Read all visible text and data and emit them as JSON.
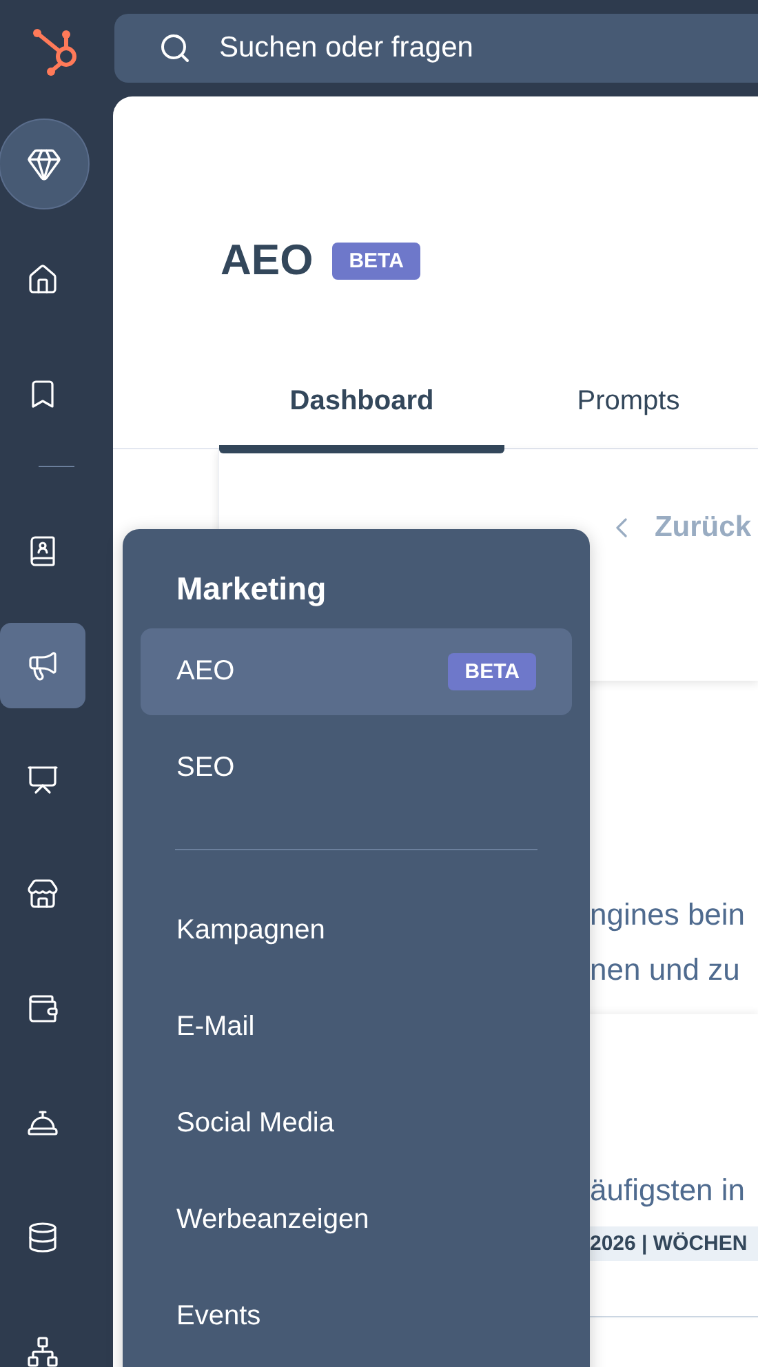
{
  "search": {
    "placeholder": "Suchen oder fragen"
  },
  "sidebar": {
    "items": [
      {
        "kind": "diamond",
        "selected": false
      },
      {
        "kind": "home",
        "selected": false
      },
      {
        "kind": "bookmark",
        "selected": false
      },
      {
        "kind": "divider"
      },
      {
        "kind": "contacts",
        "selected": false
      },
      {
        "kind": "megaphone",
        "selected": true
      },
      {
        "kind": "report",
        "selected": false
      },
      {
        "kind": "store",
        "selected": false
      },
      {
        "kind": "wallet",
        "selected": false
      },
      {
        "kind": "bell",
        "selected": false
      },
      {
        "kind": "database",
        "selected": false
      },
      {
        "kind": "network",
        "selected": false
      }
    ]
  },
  "page": {
    "title": "AEO",
    "badge": "BETA",
    "tabs": [
      {
        "label": "Dashboard",
        "selected": true
      },
      {
        "label": "Prompts",
        "selected": false
      }
    ],
    "back_link": "Zurück",
    "text_lines": [
      "ngines bein",
      "nen und zu"
    ],
    "section_text": "äufigsten in",
    "band_text": "2026 | WÖCHEN"
  },
  "menu": {
    "title": "Marketing",
    "items": [
      {
        "kind": "link",
        "label": "AEO",
        "badge": "BETA",
        "selected": true
      },
      {
        "kind": "link",
        "label": "SEO",
        "selected": false
      },
      {
        "kind": "divider"
      },
      {
        "kind": "link",
        "label": "Kampagnen",
        "selected": false
      },
      {
        "kind": "link",
        "label": "E-Mail",
        "selected": false
      },
      {
        "kind": "link",
        "label": "Social Media",
        "selected": false
      },
      {
        "kind": "link",
        "label": "Werbeanzeigen",
        "selected": false
      },
      {
        "kind": "link",
        "label": "Events",
        "selected": false
      }
    ]
  }
}
